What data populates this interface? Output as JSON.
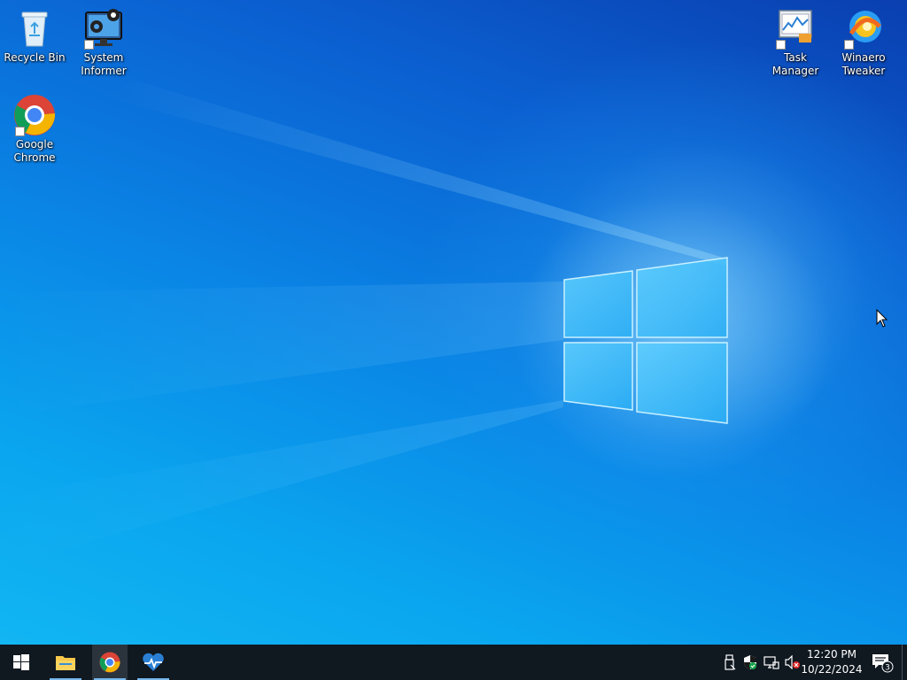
{
  "desktop": {
    "icons_left": [
      {
        "label": "Recycle Bin",
        "icon": "recycle-bin-icon"
      },
      {
        "label": "System Informer",
        "icon": "system-informer-icon"
      },
      {
        "label": "Google Chrome",
        "icon": "chrome-icon"
      }
    ],
    "icons_right": [
      {
        "label": "Task Manager",
        "icon": "task-manager-icon"
      },
      {
        "label": "Winaero Tweaker",
        "icon": "winaero-tweaker-icon"
      }
    ]
  },
  "taskbar": {
    "start_icon": "windows-start-icon",
    "pinned": [
      {
        "name": "File Explorer",
        "icon": "file-explorer-icon",
        "running": true,
        "active": false
      },
      {
        "name": "Google Chrome",
        "icon": "chrome-icon",
        "running": true,
        "active": true
      },
      {
        "name": "System Informer",
        "icon": "system-informer-taskbar-icon",
        "running": true,
        "active": false
      }
    ],
    "tray": {
      "icons": [
        "usb-device-icon",
        "windows-security-icon",
        "network-icon",
        "volume-muted-icon"
      ],
      "time": "12:20 PM",
      "date": "10/22/2024",
      "notification_count": "3"
    }
  },
  "colors": {
    "taskbar": "#101820",
    "running_indicator": "#76b9ed",
    "wallpaper_blue": "#0a86e6"
  }
}
